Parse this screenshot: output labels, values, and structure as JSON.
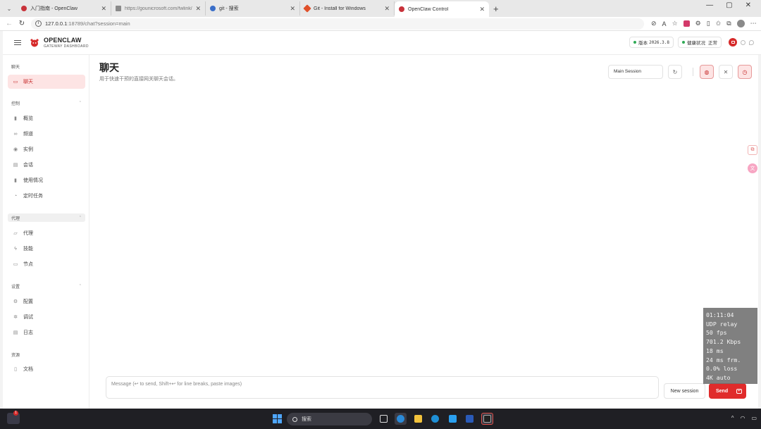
{
  "browser": {
    "tabs": [
      {
        "title": "入门指南 - OpenClaw",
        "color": "#c8323a",
        "active": false
      },
      {
        "title": "https://gounicrosoft.com/fwlink/?l",
        "color": "#8a8a8a",
        "active": false
      },
      {
        "title": "git - 搜索",
        "color": "#3a6ec8",
        "active": false
      },
      {
        "title": "Git - Install for Windows",
        "color": "#e0502a",
        "active": false
      },
      {
        "title": "OpenClaw Control",
        "color": "#c8323a",
        "active": true
      }
    ],
    "url_host": "127.0.0.1",
    "url_path": ":18789/chat?session=main"
  },
  "app": {
    "brand_name": "OPENCLAW",
    "brand_sub": "GATEWAY DASHBOARD",
    "version_label": "版本",
    "version_value": "2026.3.8",
    "health_label": "健康状况",
    "health_value": "正常",
    "accent": "#e02b2b"
  },
  "sidebar": {
    "sections": [
      {
        "label": "聊天",
        "items": [
          {
            "label": "聊天",
            "icon": "chat-icon",
            "active": true
          }
        ]
      },
      {
        "label": "控制",
        "items": [
          {
            "label": "概览",
            "icon": "bar-chart-icon"
          },
          {
            "label": "频道",
            "icon": "link-icon"
          },
          {
            "label": "实例",
            "icon": "broadcast-icon"
          },
          {
            "label": "会话",
            "icon": "document-icon"
          },
          {
            "label": "使用情况",
            "icon": "usage-chart-icon"
          },
          {
            "label": "定时任务",
            "icon": "clock-icon"
          }
        ]
      },
      {
        "label": "代理",
        "items": [
          {
            "label": "代理",
            "icon": "folder-icon"
          },
          {
            "label": "技能",
            "icon": "lightning-icon"
          },
          {
            "label": "节点",
            "icon": "monitor-icon"
          }
        ]
      },
      {
        "label": "设置",
        "items": [
          {
            "label": "配置",
            "icon": "gear-icon"
          },
          {
            "label": "调试",
            "icon": "bug-icon"
          },
          {
            "label": "日志",
            "icon": "log-icon"
          }
        ]
      },
      {
        "label": "资源",
        "items": [
          {
            "label": "文档",
            "icon": "book-icon"
          }
        ]
      }
    ]
  },
  "main": {
    "title": "聊天",
    "subtitle": "用于快速干预的直接网关聊天会话。",
    "session_select": "Main Session",
    "composer_placeholder": "Message (↩ to send, Shift+↩ for line breaks, paste images)",
    "new_session_label": "New session",
    "send_label": "Send"
  },
  "stats_overlay": [
    "01:11:04",
    "UDP relay",
    "50 fps",
    "701.2 Kbps",
    "18 ms",
    "24 ms frm.",
    "0.0% loss",
    "4K auto"
  ],
  "taskbar": {
    "search_label": "搜索",
    "notification_count": "1"
  }
}
